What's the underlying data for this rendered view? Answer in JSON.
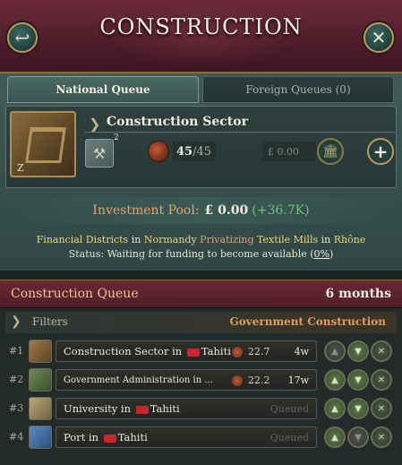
{
  "header": {
    "title": "CONSTRUCTION"
  },
  "tabs": [
    {
      "label": "National Queue",
      "active": true
    },
    {
      "label": "Foreign Queues (0)",
      "active": false
    }
  ],
  "sector": {
    "title": "Construction Sector",
    "level_current": "45",
    "level_max": "/45",
    "tool_count": "2",
    "image_level": "Z",
    "cost": "£ 0.00"
  },
  "investment": {
    "label": "Investment Pool:",
    "value": "£ 0.00",
    "gain_open": "(",
    "gain": "+36.7K",
    "gain_close": ")"
  },
  "info": {
    "line1_a": "Financial Districts",
    "line1_b": " in ",
    "line1_c": "Normandy",
    "line1_d": " Privatizing",
    "line1_e": " Textile Mills",
    "line1_f": " in ",
    "line1_g": "Rhône",
    "status_prefix": "Status: Waiting for funding to become available (",
    "status_pct": "0%",
    "status_suffix": ")"
  },
  "queue": {
    "title": "Construction Queue",
    "duration": "6 months",
    "filters_label": "Filters",
    "gov_label": "Government Construction",
    "items": [
      {
        "num": "#1",
        "name": "Construction Sector",
        "in": " in ",
        "place": "Tahiti",
        "rate": "22.7",
        "weeks": "4w"
      },
      {
        "num": "#2",
        "name": "Government Administration",
        "in": " in ",
        "place": "...",
        "rate": "22.2",
        "weeks": "17w"
      },
      {
        "num": "#3",
        "name": "University",
        "in": " in ",
        "place": "Tahiti",
        "status": "Queued"
      },
      {
        "num": "#4",
        "name": "Port",
        "in": " in ",
        "place": "Tahiti",
        "status": "Queued"
      }
    ]
  },
  "colors": {
    "header": "#6b2a3a",
    "panel": "#3f5a57",
    "accent_gold": "#b8995a",
    "gain_green": "#6ec27a",
    "gov_orange": "#e59a50"
  },
  "icons": [
    "back-icon",
    "close-icon",
    "construction-sector-image",
    "tools-icon",
    "wood-icon",
    "bank-icon",
    "plus-icon",
    "flag-icon",
    "move-up-icon",
    "move-down-icon",
    "remove-icon"
  ]
}
